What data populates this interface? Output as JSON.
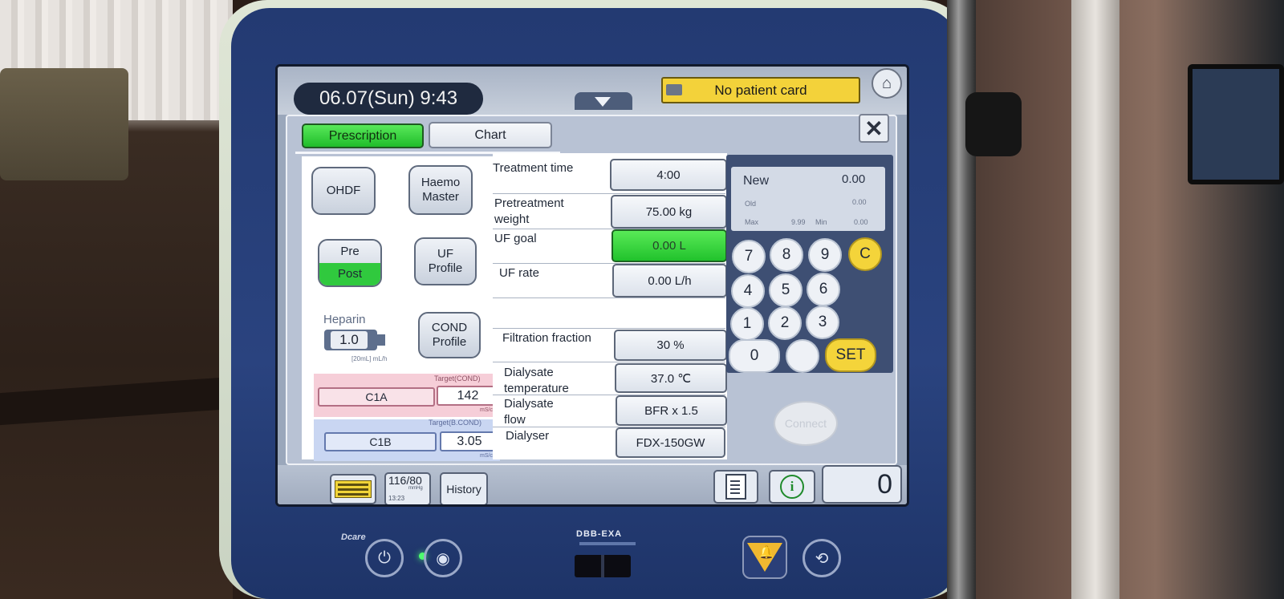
{
  "header": {
    "datetime": "06.07(Sun)  9:43",
    "patient_card": "No patient card"
  },
  "tabs": {
    "prescription": "Prescription",
    "chart": "Chart"
  },
  "left": {
    "ohdf": "OHDF",
    "haemo_master": "Haemo\nMaster",
    "pre": "Pre",
    "post": "Post",
    "uf_profile": "UF\nProfile",
    "heparin_label": "Heparin",
    "heparin_value": "1.0",
    "heparin_unit": "[20mL] mL/h",
    "cond_profile": "COND\nProfile",
    "target_cond_label": "Target(COND)",
    "c1a": "C1A",
    "cond_a_value": "142",
    "cond_a_unit": "mS/cm",
    "target_bcond_label": "Target(B.COND)",
    "c1b": "C1B",
    "cond_b_value": "3.05",
    "cond_b_unit": "mS/cm"
  },
  "params": [
    {
      "label": "Treatment time",
      "value": "4:00"
    },
    {
      "label": "Pretreatment\nweight",
      "value": "75.00 kg"
    },
    {
      "label": "UF goal",
      "value": "0.00 L"
    },
    {
      "label": "UF rate",
      "value": "0.00 L/h"
    },
    {
      "label": "Filtration fraction",
      "value": "30 %"
    },
    {
      "label": "Dialysate\ntemperature",
      "value": "37.0 ℃"
    },
    {
      "label": "Dialysate\nflow",
      "value": "BFR x 1.5"
    },
    {
      "label": "Dialyser",
      "value": "FDX-150GW"
    }
  ],
  "keypad": {
    "new_label": "New",
    "new_value": "0.00",
    "old_label": "Old",
    "old_value": "0.00",
    "max_label": "Max",
    "max_value": "9.99",
    "min_label": "Min",
    "min_value": "0.00",
    "keys": [
      "7",
      "8",
      "9",
      "C",
      "4",
      "5",
      "6",
      "1",
      "2",
      "3",
      "0",
      "",
      "SET"
    ],
    "connect": "Connect"
  },
  "bottom": {
    "bp_value": "116/80",
    "bp_unit": "mmHg",
    "bp_time": "13:23",
    "history": "History",
    "counter": "0"
  },
  "device": {
    "model": "DBB-EXA",
    "brand": "Dcare"
  },
  "icons": {
    "home": "home-icon",
    "close": "close-icon",
    "expand": "chevron-down-icon",
    "card": "card-icon",
    "monitor": "monitor-icon",
    "document": "document-icon",
    "info": "info-icon",
    "alarm": "alarm-icon",
    "mute": "mute-icon",
    "power": "power-icon",
    "standby": "standby-icon"
  },
  "colors": {
    "active_green": "#30c93e",
    "card_yellow": "#f3d23a",
    "cond_a_pink": "#f6ced8",
    "cond_b_blue": "#c9d6f2",
    "keypad_bg": "#3e4f73"
  }
}
